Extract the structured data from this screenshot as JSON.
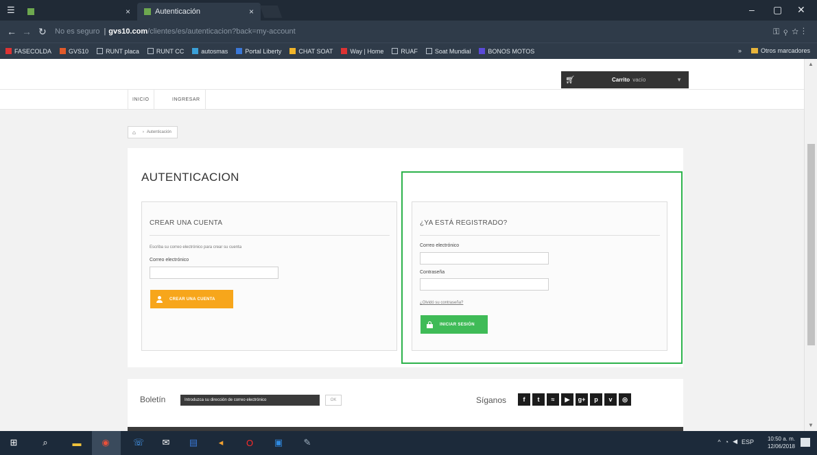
{
  "browser": {
    "inactive_tab": {
      "label": ""
    },
    "active_tab": {
      "label": "Autenticación"
    },
    "address": {
      "security": "No es seguro",
      "domain": "gvs10.com",
      "path": "/clientes/es/autenticacion?back=my-account"
    },
    "bookmarks": [
      "FASECOLDA",
      "GVS10",
      "RUNT placa",
      "RUNT CC",
      "autosmas",
      "Portal Liberty",
      "CHAT SOAT",
      "Way | Home",
      "RUAF",
      "Soat Mundial",
      "BONOS MOTOS"
    ],
    "other_bookmarks": "Otros marcadores"
  },
  "header": {
    "cart_label": "Carrito",
    "cart_state": "vacío",
    "menu": [
      "INICIO",
      "INGRESAR"
    ]
  },
  "breadcrumb": {
    "current": "Autenticación"
  },
  "page": {
    "title": "AUTENTICACION"
  },
  "create_account": {
    "title": "CREAR UNA CUENTA",
    "instruction": "Escriba su correo electrónico para crear su cuenta",
    "email_label": "Correo electrónico",
    "button": "CREAR UNA CUENTA"
  },
  "login": {
    "title": "¿YA ESTÁ REGISTRADO?",
    "email_label": "Correo electrónico",
    "password_label": "Contraseña",
    "forgot_link": "¿Olvidó su contraseña?",
    "button": "INICIAR SESIÓN"
  },
  "footer": {
    "newsletter_label": "Boletín",
    "newsletter_placeholder": "Introduzca su dirección de correo electrónico",
    "newsletter_ok": "OK",
    "follow_label": "Síganos",
    "social": [
      {
        "name": "facebook",
        "glyph": "f"
      },
      {
        "name": "twitter",
        "glyph": "t"
      },
      {
        "name": "rss",
        "glyph": "≈"
      },
      {
        "name": "youtube",
        "glyph": "▶"
      },
      {
        "name": "google-plus",
        "glyph": "g+"
      },
      {
        "name": "pinterest",
        "glyph": "p"
      },
      {
        "name": "vimeo",
        "glyph": "v"
      },
      {
        "name": "instagram",
        "glyph": "◎"
      }
    ]
  },
  "taskbar": {
    "language": "ESP",
    "time": "10:50 a. m.",
    "date": "12/06/2018"
  },
  "colors": {
    "orange_button": "#f7a61b",
    "green_button": "#3fbb57",
    "highlight_border": "#2bb24a",
    "chrome_dark": "#2f3b49"
  }
}
